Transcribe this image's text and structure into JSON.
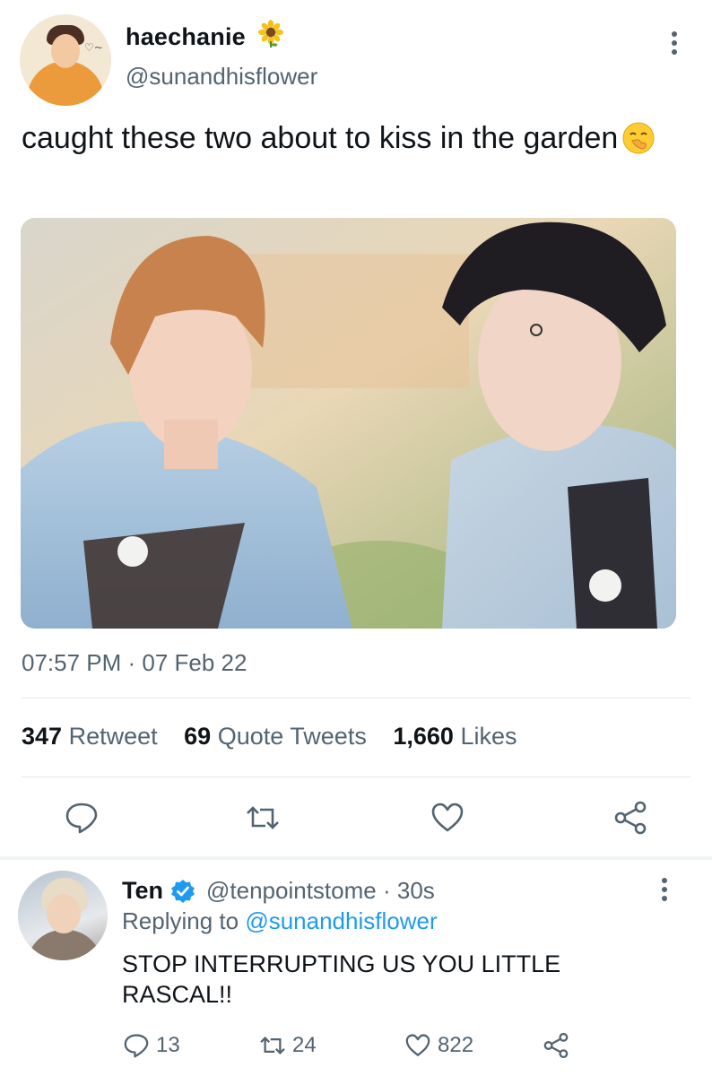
{
  "tweet": {
    "author_name": "haechanie",
    "author_handle": "@sunandhisflower",
    "text": "caught these two about to kiss in the garden",
    "timestamp": "07:57 PM · 07 Feb 22",
    "stats": {
      "retweets_count": "347",
      "retweets_label": "Retweet",
      "quotes_count": "69",
      "quotes_label": "Quote Tweets",
      "likes_count": "1,660",
      "likes_label": "Likes"
    },
    "icons": {
      "name_emoji": "sunflower-emoji",
      "text_emoji": "face-with-hand-over-mouth-emoji",
      "actions": [
        "reply-icon",
        "retweet-icon",
        "like-icon",
        "share-icon"
      ],
      "more": "more-vertical-icon"
    }
  },
  "reply": {
    "author_name": "Ten",
    "author_handle": "@tenpointstome",
    "separator": "·",
    "time": "30s",
    "replying_to_label": "Replying to",
    "replying_to_handle": "@sunandhisflower",
    "text": "STOP INTERRUPTING US YOU LITTLE RASCAL!!",
    "reply_count": "13",
    "retweet_count": "24",
    "like_count": "822",
    "icons": {
      "verified": "verified-badge-icon",
      "actions": [
        "reply-icon",
        "retweet-icon",
        "like-icon",
        "share-icon"
      ]
    }
  },
  "colors": {
    "text": "#0f1419",
    "secondary": "#536471",
    "link": "#1d9bf0",
    "divider": "#e1e8ed",
    "verified": "#1d9bf0"
  }
}
